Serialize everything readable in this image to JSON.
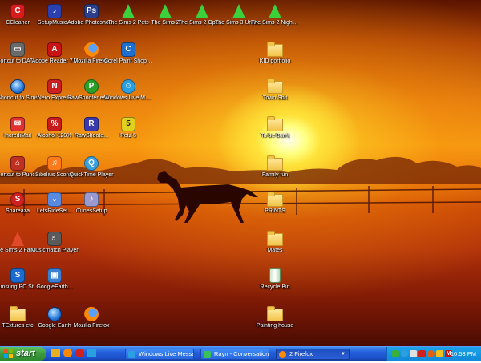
{
  "desktop": {
    "icons": [
      {
        "id": "ccleaner",
        "label": "CCleaner",
        "icon": "ccleaner-icon",
        "color": "#d81b1b"
      },
      {
        "id": "setupmusic",
        "label": "SetupMusic...",
        "icon": "setup-music-icon",
        "color": "#2a3fb0"
      },
      {
        "id": "photoshop",
        "label": "Adobe Photoshop ...",
        "icon": "photoshop-icon",
        "color": "#2b3f8c"
      },
      {
        "id": "sims2pets",
        "label": "The Sims 2 Pets",
        "icon": "sims-icon",
        "color": "#3ad13a"
      },
      {
        "id": "sims2",
        "label": "The Sims 2",
        "icon": "sims-icon",
        "color": "#3ad13a"
      },
      {
        "id": "sims2openf",
        "label": "The Sims 2 Open F...",
        "icon": "sims-icon",
        "color": "#3ad13a"
      },
      {
        "id": "sims3univ",
        "label": "The Sims 3 Universi...",
        "icon": "sims-icon",
        "color": "#3ad13a"
      },
      {
        "id": "sims2night",
        "label": "The Sims 2 Nightlife",
        "icon": "sims-icon",
        "color": "#3ad13a"
      },
      {
        "id": "shortcutdata",
        "label": "Shortcut to DATA BACK...",
        "icon": "drive-icon",
        "color": "#6a6a6a"
      },
      {
        "id": "adobereader",
        "label": "Adobe Reader 7.0",
        "icon": "adobe-reader-icon",
        "color": "#c81414"
      },
      {
        "id": "firefox1",
        "label": "Mozilla Firefox",
        "icon": "firefox-icon",
        "color": "#ff8a00"
      },
      {
        "id": "corel",
        "label": "Corel Paint Shop Pro Ph...",
        "icon": "corel-icon",
        "color": "#1f6fd0"
      },
      {
        "id": "kidportfolio",
        "label": "KID portfolio",
        "icon": "folder-icon",
        "color": "#f2c44a"
      },
      {
        "id": "shortcutsims",
        "label": "Shortcut to Sims",
        "icon": "globe-icon",
        "color": "#2277d8"
      },
      {
        "id": "nero",
        "label": "Nero Express",
        "icon": "nero-icon",
        "color": "#cc2020"
      },
      {
        "id": "rawshooter",
        "label": "RawShooter essentials 2006",
        "icon": "rawshooter-icon",
        "color": "#2aa02a"
      },
      {
        "id": "wlm",
        "label": "Windows Live Messenger",
        "icon": "messenger-icon",
        "color": "#2ba0e0"
      },
      {
        "id": "townsbit",
        "label": "Town Sbit",
        "icon": "folder-icon",
        "color": "#f2c44a"
      },
      {
        "id": "incredimail",
        "label": "IncrediMail",
        "icon": "mail-icon",
        "color": "#e03030"
      },
      {
        "id": "alcohol",
        "label": "Alcohol 120%",
        "icon": "alcohol-icon",
        "color": "#c81c1c"
      },
      {
        "id": "rawshooter2",
        "label": "RawShoote...",
        "icon": "rawshooter-icon",
        "color": "#3a3ab0"
      },
      {
        "id": "petz5",
        "label": "Petz 5",
        "icon": "petz-icon",
        "color": "#e0d020"
      },
      {
        "id": "tobeburnt",
        "label": "To be Burnt",
        "icon": "folder-icon",
        "color": "#f2c44a"
      },
      {
        "id": "shortcutpunch",
        "label": "Shortcut to PunchHome...",
        "icon": "punch-icon",
        "color": "#c03020"
      },
      {
        "id": "sibelius",
        "label": "Sibelius Scorch",
        "icon": "sibelius-icon",
        "color": "#ff7a1a"
      },
      {
        "id": "quicktime",
        "label": "QuickTime Player",
        "icon": "quicktime-icon",
        "color": "#3aa0e0"
      },
      {
        "id": "familyfun",
        "label": "Family fun",
        "icon": "folder-icon",
        "color": "#f2c44a"
      },
      {
        "id": "shareaza",
        "label": "Shareaza",
        "icon": "shareaza-icon",
        "color": "#d02020"
      },
      {
        "id": "letsridesetup",
        "label": "LetsRideSet...",
        "icon": "setup-icon",
        "color": "#5a8ae0"
      },
      {
        "id": "itunessetup",
        "label": "iTunesSetup",
        "icon": "itunes-icon",
        "color": "#9a9ad0"
      },
      {
        "id": "prints",
        "label": "PRINTS",
        "icon": "folder-icon",
        "color": "#f2c44a"
      },
      {
        "id": "sims2family",
        "label": "The Sims 2 Family F...",
        "icon": "sims-icon",
        "color": "#e04a2a"
      },
      {
        "id": "musicmatch",
        "label": "Musicmatch Player",
        "icon": "musicmatch-icon",
        "color": "#5a5a5a"
      },
      {
        "id": "mates",
        "label": "Mates",
        "icon": "folder-icon",
        "color": "#f2c44a"
      },
      {
        "id": "samsung",
        "label": "Samsung PC Studio 3",
        "icon": "samsung-icon",
        "color": "#1a6ad0"
      },
      {
        "id": "googleearth1",
        "label": "GoogleEarth...",
        "icon": "setup-icon",
        "color": "#3a80d0"
      },
      {
        "id": "recyclebin",
        "label": "Recycle Bin",
        "icon": "recycle-bin-icon",
        "color": "#5a8a5a"
      },
      {
        "id": "textures",
        "label": "TExtures etc",
        "icon": "folder-icon",
        "color": "#f2c44a"
      },
      {
        "id": "googleearth2",
        "label": "Google Earth",
        "icon": "google-earth-icon",
        "color": "#2277d8"
      },
      {
        "id": "firefox2",
        "label": "Mozilla Firefox",
        "icon": "firefox-icon",
        "color": "#ff8a00"
      },
      {
        "id": "paintinghouse",
        "label": "Painting house",
        "icon": "folder-icon",
        "color": "#f2c44a"
      }
    ]
  },
  "taskbar": {
    "start_label": "start",
    "quick_launch": [
      {
        "icon": "media-icon",
        "color": "#e8b020"
      },
      {
        "icon": "firefox-icon",
        "color": "#ff8a00"
      },
      {
        "icon": "opera-icon",
        "color": "#d02020"
      },
      {
        "icon": "ie-icon",
        "color": "#2aa0e0"
      }
    ],
    "tasks": [
      {
        "label": "Windows Live Messen...",
        "icon": "messenger-icon",
        "color": "#2ba0e0",
        "active": false
      },
      {
        "label": "Rayn - Conversation",
        "icon": "messenger-icon",
        "color": "#3ac05a",
        "active": false
      },
      {
        "label": "2 Firefox",
        "icon": "firefox-icon",
        "color": "#ff8a00",
        "active": true
      }
    ],
    "tray_icons": [
      {
        "icon": "network-icon",
        "color": "#3ab03a"
      },
      {
        "icon": "messenger-tray-icon",
        "color": "#2ba0e0"
      },
      {
        "icon": "volume-icon",
        "color": "#e0e0e0"
      },
      {
        "icon": "shield-icon",
        "color": "#d02020"
      },
      {
        "icon": "antivirus-icon",
        "color": "#e06010"
      },
      {
        "icon": "update-icon",
        "color": "#f0c020"
      },
      {
        "icon": "gmail-icon",
        "color": "#c81414"
      }
    ],
    "clock": "10:53 PM"
  }
}
